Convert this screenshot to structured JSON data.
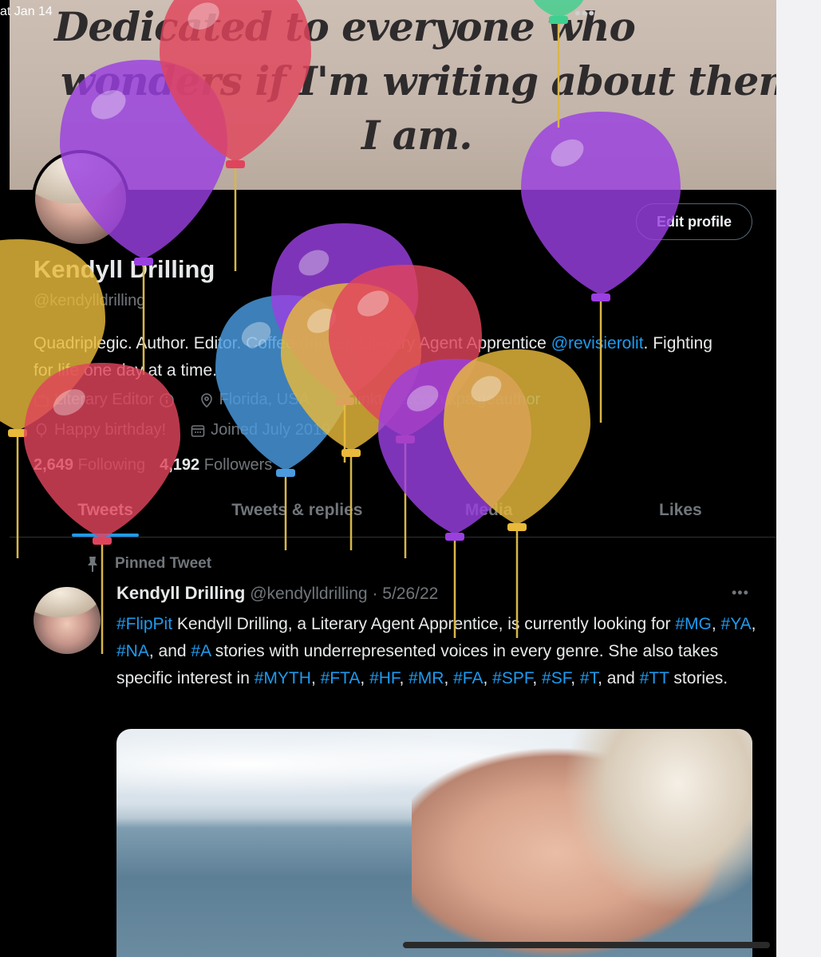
{
  "status": {
    "time": "at Jan 14",
    "more_dots": "•••"
  },
  "banner": {
    "line1": "Dedicated to everyone who",
    "line2": "wonders if I'm writing about them.",
    "line3": "I am."
  },
  "profile": {
    "edit_label": "Edit profile",
    "display_name": "Kendyll Drilling",
    "handle": "@kendylldrilling",
    "bio_part1": "Quadriplegic. Author. Editor. Coffee drinker. Literary Agent Apprentice",
    "bio_link": "@revisierolit",
    "bio_part2": ". Fighting for life one day at a time.",
    "category": "Literary Editor",
    "location": "Florida, USA",
    "website": "linktr.ee.com/kpaigeauthor",
    "birthday": "Happy birthday!",
    "joined": "Joined July 2019",
    "following_count": "2,649",
    "following_label": "Following",
    "followers_count": "4,192",
    "followers_label": "Followers"
  },
  "tabs": [
    {
      "label": "Tweets",
      "active": true
    },
    {
      "label": "Tweets & replies",
      "active": false
    },
    {
      "label": "Media",
      "active": false
    },
    {
      "label": "Likes",
      "active": false
    }
  ],
  "pinned_tweet": {
    "pinned_label": "Pinned Tweet",
    "name": "Kendyll Drilling",
    "handle": "@kendylldrilling",
    "date": "5/26/22",
    "more": "•••",
    "text": [
      {
        "t": "#FlipPit",
        "tag": true
      },
      {
        "t": " Kendyll Drilling, a Literary Agent Apprentice, is currently looking for ",
        "tag": false
      },
      {
        "t": "#MG",
        "tag": true
      },
      {
        "t": ", ",
        "tag": false
      },
      {
        "t": "#YA",
        "tag": true
      },
      {
        "t": ", ",
        "tag": false
      },
      {
        "t": "#NA",
        "tag": true
      },
      {
        "t": ", and ",
        "tag": false
      },
      {
        "t": "#A",
        "tag": true
      },
      {
        "t": " stories with underrepresented voices in every genre. She also takes specific interest in ",
        "tag": false
      },
      {
        "t": "#MYTH",
        "tag": true
      },
      {
        "t": ", ",
        "tag": false
      },
      {
        "t": "#FTA",
        "tag": true
      },
      {
        "t": ", ",
        "tag": false
      },
      {
        "t": "#HF",
        "tag": true
      },
      {
        "t": ", ",
        "tag": false
      },
      {
        "t": "#MR",
        "tag": true
      },
      {
        "t": ", ",
        "tag": false
      },
      {
        "t": "#FA",
        "tag": true
      },
      {
        "t": ", ",
        "tag": false
      },
      {
        "t": "#SPF",
        "tag": true
      },
      {
        "t": ", ",
        "tag": false
      },
      {
        "t": "#SF",
        "tag": true
      },
      {
        "t": ", ",
        "tag": false
      },
      {
        "t": "#T",
        "tag": true
      },
      {
        "t": ", and ",
        "tag": false
      },
      {
        "t": "#TT",
        "tag": true
      },
      {
        "t": " stories.",
        "tag": false
      }
    ]
  },
  "colors": {
    "accent": "#1d9bf0",
    "balloon_purple": "#9a3fe0",
    "balloon_red": "#e0445c",
    "balloon_yellow": "#e8b93a",
    "balloon_blue": "#4a9be0",
    "balloon_green": "#3fcf8e"
  },
  "icons": [
    "briefcase-icon",
    "location-icon",
    "link-icon",
    "balloon-icon",
    "calendar-icon",
    "pin-icon"
  ]
}
